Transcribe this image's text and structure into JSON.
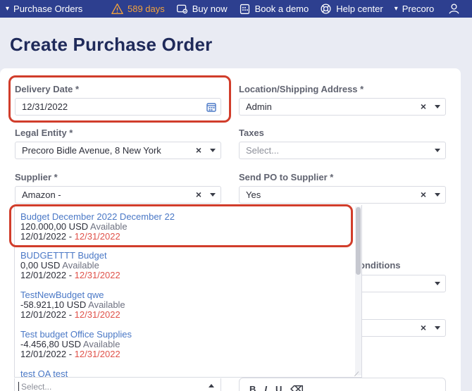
{
  "nav": {
    "breadcrumb": "Purchase Orders",
    "days": "589 days",
    "buy_now": "Buy now",
    "book_demo": "Book a demo",
    "help_center": "Help center",
    "company": "Precoro"
  },
  "page": {
    "title": "Create Purchase Order"
  },
  "form": {
    "delivery_date": {
      "label": "Delivery Date *",
      "value": "12/31/2022"
    },
    "location": {
      "label": "Location/Shipping Address *",
      "value": "Admin"
    },
    "legal_entity": {
      "label": "Legal Entity *",
      "value": "Precoro Bidle Avenue, 8 New York"
    },
    "taxes": {
      "label": "Taxes",
      "placeholder": "Select..."
    },
    "supplier": {
      "label": "Supplier *",
      "value": "Amazon -"
    },
    "send_po": {
      "label": "Send PO to Supplier *",
      "value": "Yes"
    },
    "conditions_label_partial": "onditions",
    "budget_select": {
      "placeholder": "Select..."
    }
  },
  "budgets": [
    {
      "name": "Budget December 2022 December 22",
      "amount": "120.000,00 USD",
      "available": "Available",
      "start": "12/01/2022",
      "sep": " - ",
      "end": "12/31/2022"
    },
    {
      "name": "BUDGETTTT Budget",
      "amount": "0,00 USD",
      "available": "Available",
      "start": "12/01/2022",
      "sep": " - ",
      "end": "12/31/2022"
    },
    {
      "name": "TestNewBudget qwe",
      "amount": "-58.921,10 USD",
      "available": "Available",
      "start": "12/01/2022",
      "sep": " - ",
      "end": "12/31/2022"
    },
    {
      "name": "Test budget Office Supplies",
      "amount": "-4.456,80 USD",
      "available": "Available",
      "start": "12/01/2022",
      "sep": " - ",
      "end": "12/31/2022"
    },
    {
      "name": "test QA test"
    }
  ],
  "editor": {
    "bold": "B",
    "italic": "I",
    "underline": "U"
  },
  "colors": {
    "nav": "#2d3f8f",
    "highlight": "#d13d2b",
    "link": "#4a78c6",
    "end_date": "#e0524a",
    "warning": "#f2a23c"
  },
  "icons": [
    "chevron-down-icon",
    "warning-icon",
    "cart-icon",
    "calendar-icon",
    "lifebuoy-icon",
    "user-icon"
  ]
}
